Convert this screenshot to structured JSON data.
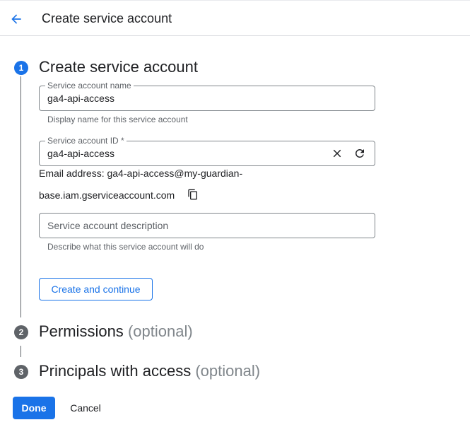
{
  "header": {
    "title": "Create service account",
    "back_icon": "arrow-back-icon"
  },
  "colors": {
    "accent": "#1a73e8",
    "text": "#202124",
    "muted": "#5f6368",
    "border": "#80868b"
  },
  "steps": [
    {
      "number": "1",
      "title": "Create service account",
      "optional": ""
    },
    {
      "number": "2",
      "title": "Permissions",
      "optional": "(optional)"
    },
    {
      "number": "3",
      "title": "Principals with access",
      "optional": "(optional)"
    }
  ],
  "form": {
    "name": {
      "label": "Service account name",
      "value": "ga4-api-access",
      "hint": "Display name for this service account"
    },
    "id": {
      "label": "Service account ID *",
      "value": "ga4-api-access",
      "clear_icon": "close-icon",
      "refresh_icon": "refresh-icon"
    },
    "email": {
      "line1": "Email address: ga4-api-access@my-guardian-",
      "line2": "base.iam.gserviceaccount.com",
      "copy_icon": "copy-icon"
    },
    "description": {
      "placeholder": "Service account description",
      "value": "",
      "hint": "Describe what this service account will do"
    },
    "continue_label": "Create and continue"
  },
  "footer": {
    "done_label": "Done",
    "cancel_label": "Cancel"
  }
}
